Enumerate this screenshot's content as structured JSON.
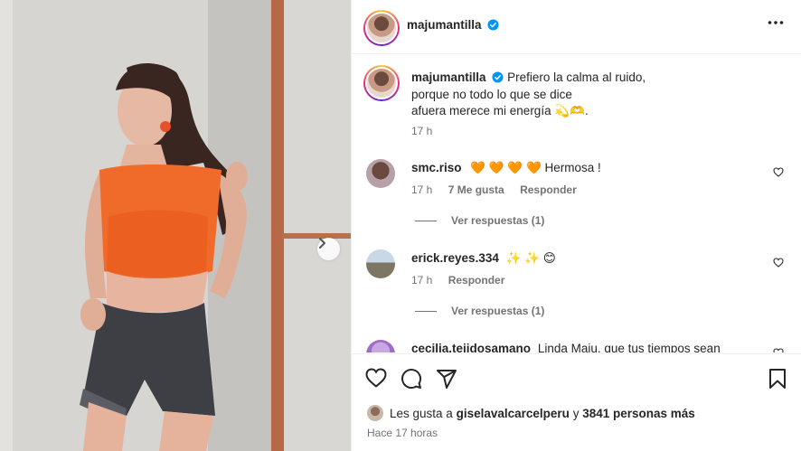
{
  "post": {
    "username": "majumantilla",
    "more_label": "Más opciones"
  },
  "caption": {
    "username": "majumantilla",
    "line1": "Prefiero la calma al ruido,",
    "line2": "porque no todo lo que se dice",
    "line3": "afuera merece mi energía 💫🫶.",
    "time": "17 h"
  },
  "comments": [
    {
      "username": "smc.riso",
      "text": "🧡 🧡 🧡 🧡  Hermosa !",
      "time": "17 h",
      "likes": "7 Me gusta",
      "reply": "Responder",
      "view_replies": "Ver respuestas (1)"
    },
    {
      "username": "erick.reyes.334",
      "text": "✨ ✨ 😊",
      "time": "17 h",
      "reply": "Responder",
      "view_replies": "Ver respuestas (1)"
    },
    {
      "username": "cecilia.tejidosamano",
      "text": "Linda Maju, que tus tiempos sean"
    }
  ],
  "footer": {
    "likes_prefix": "Les gusta a",
    "liked_by": "giselavalcarcelperu",
    "likes_middle": "y",
    "likes_count": "3841 personas más",
    "time_ago": "Hace 17 horas"
  },
  "colors": {
    "verified": "#0095f6",
    "muted": "#737373",
    "text": "#262626"
  }
}
